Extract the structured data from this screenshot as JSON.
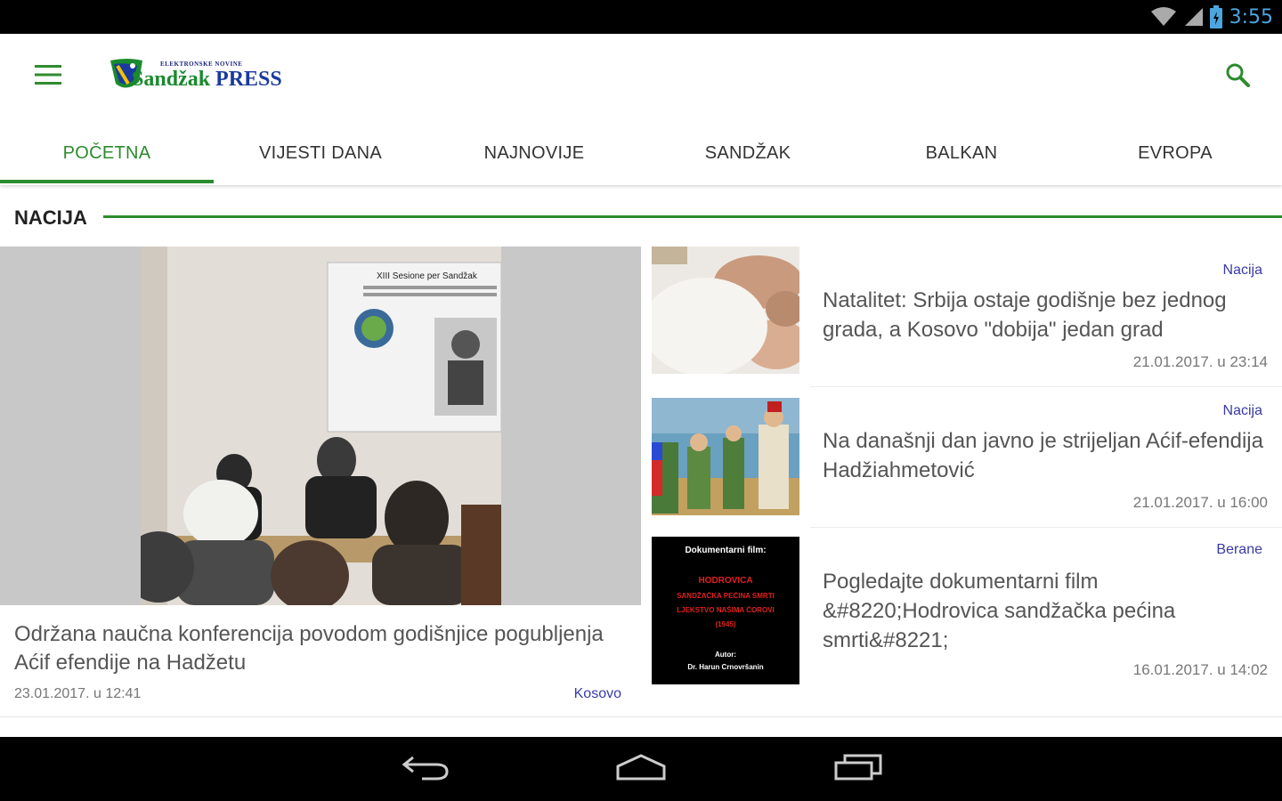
{
  "status_bar": {
    "time": "3:55",
    "icons": [
      "wifi-icon",
      "cell-signal-icon",
      "battery-icon"
    ]
  },
  "app_bar": {
    "logo_small": "ELEKTRONSKE NOVINE",
    "logo_brand_part1": "Sandžak",
    "logo_brand_part2": " PRESS",
    "icons": [
      "menu-icon",
      "search-icon"
    ]
  },
  "tabs": [
    {
      "label": "POČETNA",
      "active": true
    },
    {
      "label": "VIJESTI DANA",
      "active": false
    },
    {
      "label": "NAJNOVIJE",
      "active": false
    },
    {
      "label": "SANDŽAK",
      "active": false
    },
    {
      "label": "BALKAN",
      "active": false
    },
    {
      "label": "EVROPA",
      "active": false
    }
  ],
  "section": {
    "title": "NACIJA"
  },
  "featured": {
    "headline": "Održana naučna konferencija povodom godišnjice pogubljenja Aćif efendije na Hadžetu",
    "date": "23.01.2017. u 12:41",
    "category": "Kosovo",
    "poster_title": "XIII Sesione per Sandžak"
  },
  "articles": [
    {
      "category": "Nacija",
      "title": "Natalitet: Srbija ostaje godišnje bez jednog grada, a Kosovo \"dobija\" jedan grad",
      "date": "21.01.2017. u 23:14"
    },
    {
      "category": "Nacija",
      "title": "Na današnji dan javno je strijeljan Aćif-efendija Hadžiahmetović",
      "date": "21.01.2017. u 16:00"
    },
    {
      "category": "Berane",
      "title": "Pogledajte dokumentarni film &#8220;Hodrovica sandžačka pećina smrti&#8221;",
      "date": "16.01.2017. u 14:02",
      "thumb_lines": [
        "Dokumentarni film:",
        "HODROVICA",
        "SANDŽAČKA PEĆINA SMRTI",
        "LJEKSTVO NAŠIMA ĆOROVI",
        "(1945)",
        "Autor:",
        "Dr. Harun Crnovršanin"
      ]
    }
  ],
  "nav_bar": {
    "icons": [
      "back-icon",
      "home-icon",
      "recents-icon"
    ]
  },
  "colors": {
    "accent_green": "#2e8b2e",
    "category_blue": "#3a3aa8",
    "status_time_blue": "#4ba6e0"
  }
}
